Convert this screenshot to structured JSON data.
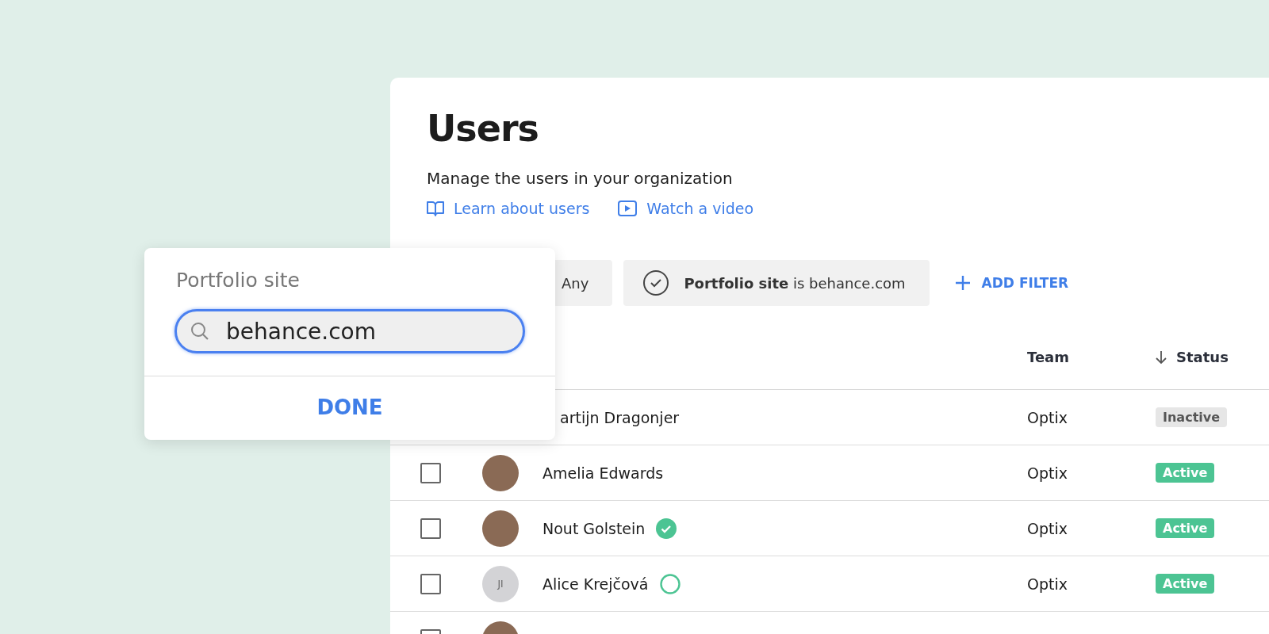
{
  "page": {
    "title": "Users",
    "subtitle": "Manage the users in your organization",
    "links": [
      {
        "kind": "book",
        "label": "Learn about users"
      },
      {
        "kind": "video",
        "label": "Watch a video"
      }
    ]
  },
  "filters": [
    {
      "kind": "partial",
      "label": "Any"
    },
    {
      "kind": "applied",
      "label": "**Portfolio site** is behance.com"
    }
  ],
  "add_filter": "ADD FILTER",
  "table": {
    "columns": [
      {
        "label": "Team",
        "sorted": false
      },
      {
        "label": "Status",
        "sorted": true
      }
    ],
    "rows": [
      {
        "name": "artijn Dragonjer",
        "team": "Optix",
        "status": {
          "kind": "inactive",
          "label": "Inactive"
        }
      },
      {
        "checked": false,
        "avatar": {
          "kind": "photo"
        },
        "name": "Amelia Edwards",
        "team": "Optix",
        "status": {
          "kind": "active",
          "label": "Active"
        }
      },
      {
        "checked": false,
        "avatar": {
          "kind": "photo"
        },
        "name": "Nout Golstein",
        "badge": {
          "kind": "check"
        },
        "team": "Optix",
        "status": {
          "kind": "active",
          "label": "Active"
        }
      },
      {
        "checked": false,
        "avatar": {
          "kind": "initials",
          "initials": "JI"
        },
        "name": "Alice Krejčová",
        "badge": {
          "kind": "ring"
        },
        "team": "Optix",
        "status": {
          "kind": "active",
          "label": "Active"
        }
      },
      {
        "checked": false,
        "avatar": {
          "kind": "photo"
        }
      }
    ]
  },
  "popover": {
    "label": "Portfolio site",
    "value": "behance.com",
    "button": "DONE"
  }
}
